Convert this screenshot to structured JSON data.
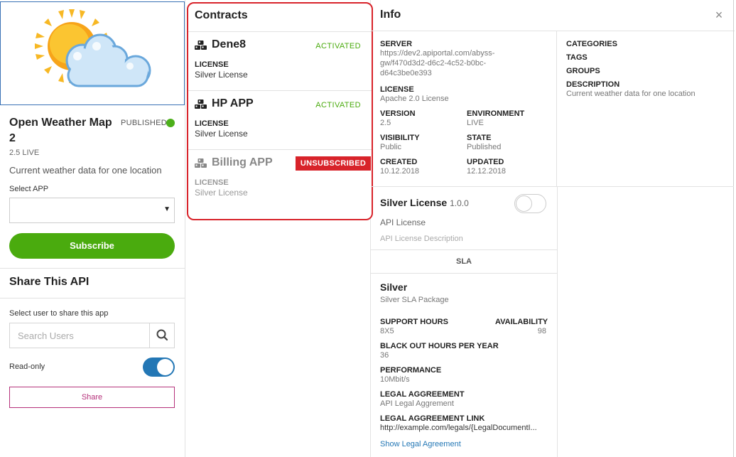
{
  "api": {
    "title": "Open Weather Map 2",
    "status": "PUBLISHED",
    "version_live": "2.5 LIVE",
    "description": "Current weather data for one location",
    "select_app_label": "Select APP",
    "select_app_value": "",
    "subscribe_label": "Subscribe"
  },
  "share": {
    "title": "Share This API",
    "select_user_label": "Select user to share this app",
    "search_placeholder": "Search Users",
    "readonly_label": "Read-only",
    "readonly_on": true,
    "share_label": "Share"
  },
  "contracts": {
    "title": "Contracts",
    "items": [
      {
        "name": "Dene8",
        "status": "ACTIVATED",
        "license_label": "LICENSE",
        "license": "Silver License"
      },
      {
        "name": "HP APP",
        "status": "ACTIVATED",
        "license_label": "LICENSE",
        "license": "Silver License"
      },
      {
        "name": "Billing APP",
        "status": "UNSUBSCRIBED",
        "license_label": "LICENSE",
        "license": "Silver License"
      }
    ],
    "colors": {
      "activated": "#4aab0e",
      "unsubscribed": "#d8232a",
      "highlight_border": "#d8232a"
    }
  },
  "info": {
    "title": "Info",
    "close_glyph": "×",
    "server_label": "SERVER",
    "server_lines": [
      "https://dev2.apiportal.com/abyss-",
      "gw/f470d3d2-d6c2-4c52-b0bc-",
      "d64c3be0e393"
    ],
    "license_label": "LICENSE",
    "license": "Apache 2.0 License",
    "version_label": "VERSION",
    "version": "2.5",
    "environment_label": "ENVIRONMENT",
    "environment": "LIVE",
    "visibility_label": "VISIBILITY",
    "visibility": "Public",
    "state_label": "STATE",
    "state": "Published",
    "created_label": "CREATED",
    "created": "10.12.2018",
    "updated_label": "UPDATED",
    "updated": "12.12.2018",
    "categories_label": "CATEGORIES",
    "tags_label": "TAGS",
    "groups_label": "GROUPS",
    "description_label": "DESCRIPTION",
    "description": "Current weather data for one location"
  },
  "license_card": {
    "name": "Silver License",
    "version": "1.0.0",
    "enabled": false,
    "api_license": "API License",
    "api_license_desc": "API License Description",
    "sla_tab": "SLA"
  },
  "sla": {
    "name": "Silver",
    "package": "Silver SLA Package",
    "support_hours_label": "SUPPORT HOURS",
    "support_hours": "8X5",
    "availability_label": "AVAILABILITY",
    "availability": "98",
    "blackout_label": "BLACK OUT HOURS PER YEAR",
    "blackout": "36",
    "performance_label": "PERFORMANCE",
    "performance": "10Mbit/s",
    "legal_label": "LEGAL AGGREEMENT",
    "legal": "API Legal Aggrement",
    "legal_link_label": "LEGAL AGGREEMENT LINK",
    "legal_link": "http://example.com/legals/{LegalDocumentI...",
    "show_legal": "Show Legal Agreement"
  },
  "icons": {
    "weather": "sun-cloud-icon",
    "published_dot": "status-dot-icon",
    "contract": "cubes-icon",
    "search": "search-icon",
    "close": "close-icon",
    "caret": "chevron-down-icon"
  }
}
